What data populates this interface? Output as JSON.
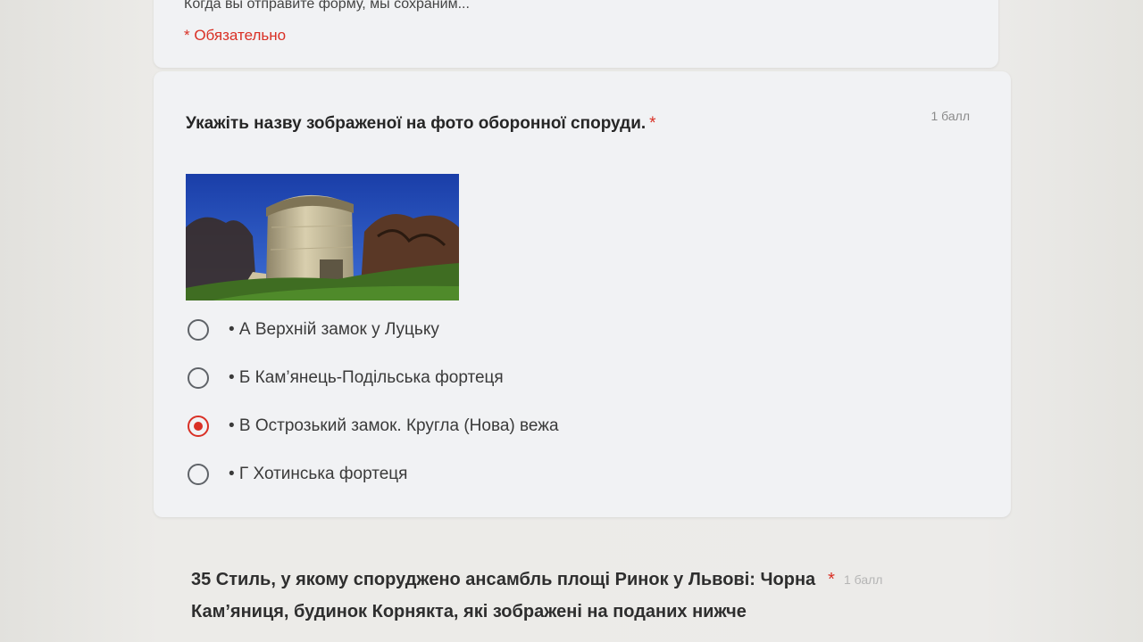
{
  "header_card": {
    "intro_text": "Когда вы отправите форму, мы сохраним...",
    "required_note": "* Обязательно"
  },
  "question": {
    "title": "Укажіть назву зображеної на фото оборонної споруди.",
    "required_star": "*",
    "points": "1 балл",
    "options": [
      {
        "label": "• А Верхній замок у Луцьку",
        "selected": false
      },
      {
        "label": "• Б Кам’янець-Подільська фортеця",
        "selected": false
      },
      {
        "label": "• В Острозький замок. Кругла (Нова) вежа",
        "selected": true
      },
      {
        "label": "• Г Хотинська фортеця",
        "selected": false
      }
    ]
  },
  "next_question": {
    "line1": "35 Стиль, у якому споруджено ансамбль площі Ринок у Львові: Чорна",
    "line2": "Кам’яниця, будинок Корнякта, які зображені на поданих нижче",
    "required_star": "*",
    "points": "1 балл"
  },
  "colors": {
    "accent": "#d93025",
    "card_bg": "#f1f2f4",
    "page_bg": "#e7e6e2"
  }
}
